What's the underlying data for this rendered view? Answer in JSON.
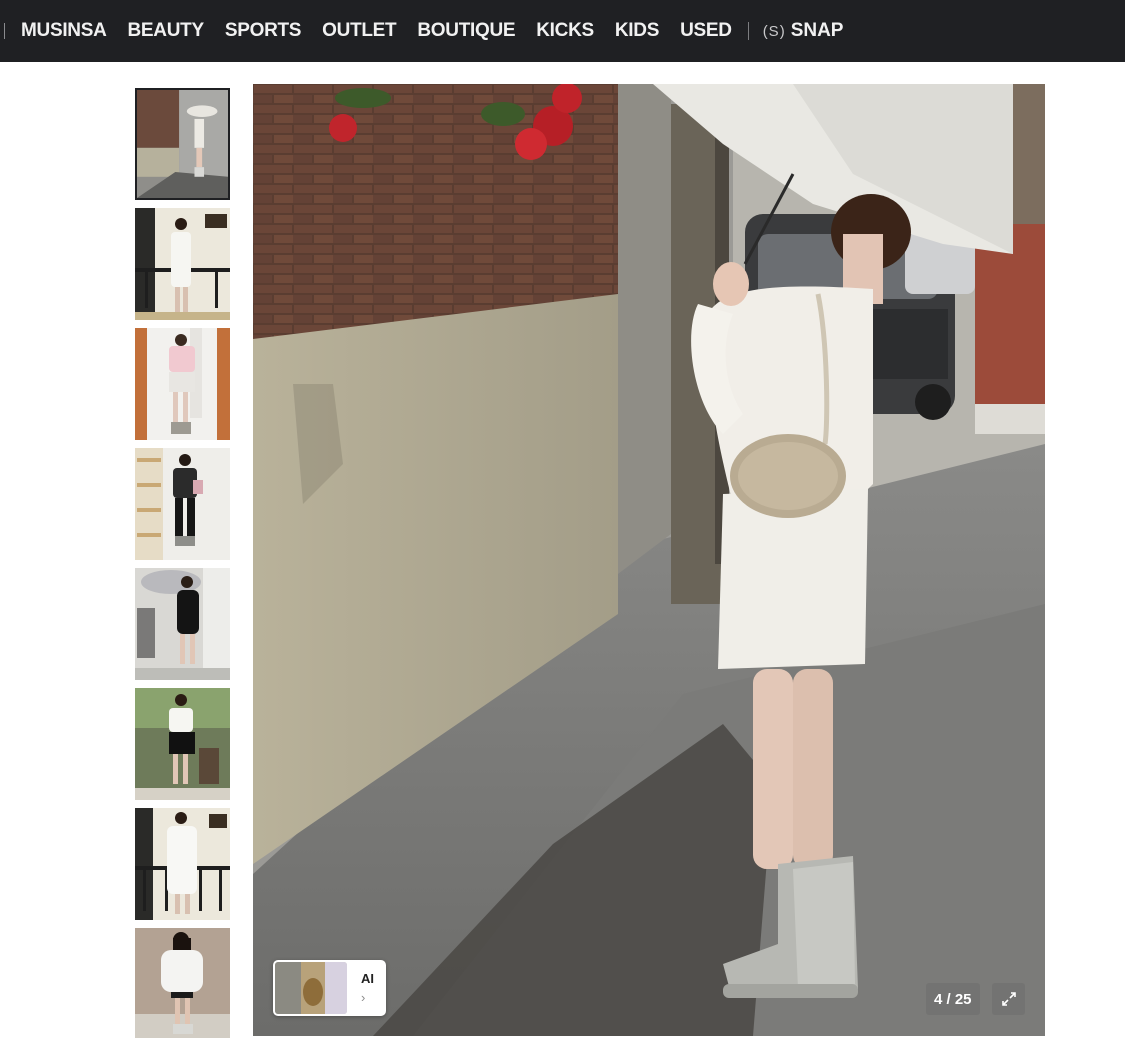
{
  "nav": {
    "items": [
      "MUSINSA",
      "BEAUTY",
      "SPORTS",
      "OUTLET",
      "BOUTIQUE",
      "KICKS",
      "KIDS",
      "USED"
    ],
    "snap_icon": "(S)",
    "snap_label": "SNAP"
  },
  "gallery": {
    "thumbnail_count": 8,
    "active_index": 0,
    "counter": "4 / 25",
    "ai_badge_label": "AI",
    "ai_chevron": "›"
  },
  "colors": {
    "nav_background": "#1f2023",
    "nav_text": "#f1f1f1",
    "page_background": "#ffffff"
  },
  "icons": {
    "snap": "snap-icon",
    "expand": "expand-icon",
    "chevron": "chevron-right-icon"
  }
}
